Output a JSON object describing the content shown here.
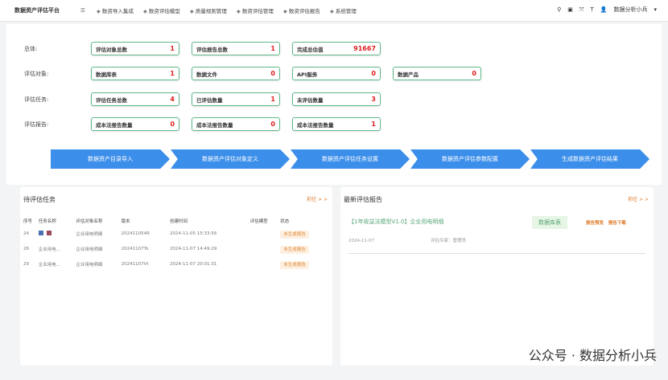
{
  "header": {
    "brand": "数据资产评估平台",
    "menu": [
      {
        "icon": "menu-fold-icon",
        "label": ""
      },
      {
        "icon": "import-icon",
        "label": "数资导入集成"
      },
      {
        "icon": "model-icon",
        "label": "数资评估模型"
      },
      {
        "icon": "rule-icon",
        "label": "质量规则管理"
      },
      {
        "icon": "manage-icon",
        "label": "数资评估管理"
      },
      {
        "icon": "report-icon",
        "label": "数资评估报告"
      },
      {
        "icon": "gear-icon",
        "label": "系统管理"
      }
    ],
    "user": "数据分析小兵"
  },
  "stats": {
    "rows": [
      {
        "label": "总体:",
        "cards": [
          {
            "name": "评估对象总数",
            "value": "1"
          },
          {
            "name": "评估报告总数",
            "value": "1"
          },
          {
            "name": "完成总估值",
            "value": "91667"
          }
        ]
      },
      {
        "label": "评估对象:",
        "cards": [
          {
            "name": "数据库表",
            "value": "1"
          },
          {
            "name": "数据文件",
            "value": "0"
          },
          {
            "name": "API服务",
            "value": "0"
          },
          {
            "name": "数据产品",
            "value": "0"
          }
        ]
      },
      {
        "label": "评估任务:",
        "cards": [
          {
            "name": "评估任务总数",
            "value": "4"
          },
          {
            "name": "已评估数量",
            "value": "1"
          },
          {
            "name": "未评估数量",
            "value": "3"
          }
        ]
      },
      {
        "label": "评估报告:",
        "cards": [
          {
            "name": "成本法报告数量",
            "value": "0"
          },
          {
            "name": "成本法报告数量",
            "value": "0"
          },
          {
            "name": "成本法报告数量",
            "value": "1"
          }
        ]
      }
    ]
  },
  "flow": [
    "数据资产目录导入",
    "数据资产评估对象定义",
    "数据资产评估任务设置",
    "数据资产评估参数配置",
    "生成数据资产评估结果"
  ],
  "tasks": {
    "title": "待评估任务",
    "more": "前往 > >",
    "columns": [
      "序号",
      "任务名称",
      "评估对象名称",
      "版本",
      "创建时间",
      "评估模型",
      "状态"
    ],
    "rows": [
      [
        "24",
        "",
        "企业用电明细",
        "202411054R",
        "2024-11-05 15:33:56",
        "",
        "未生成报告"
      ],
      [
        "26",
        "企业用电...",
        "企业用电明细",
        "20241107To",
        "2024-11-07 14:49:29",
        "",
        "未生成报告"
      ],
      [
        "29",
        "企业用电...",
        "企业用电明细",
        "20241107Vt",
        "2024-11-07 20:01:31",
        "",
        "未生成报告"
      ]
    ]
  },
  "reports": {
    "title": "最新评估报告",
    "more": "前往 > >",
    "item": {
      "title": "【1年收益法模型V1.0】企业用电明细",
      "tag": "数据库表",
      "view": "报告预览",
      "download": "报告下载",
      "date": "2024-11-07",
      "expert": "评估专家：管理员"
    }
  },
  "watermark": "公众号 · 数据分析小兵"
}
